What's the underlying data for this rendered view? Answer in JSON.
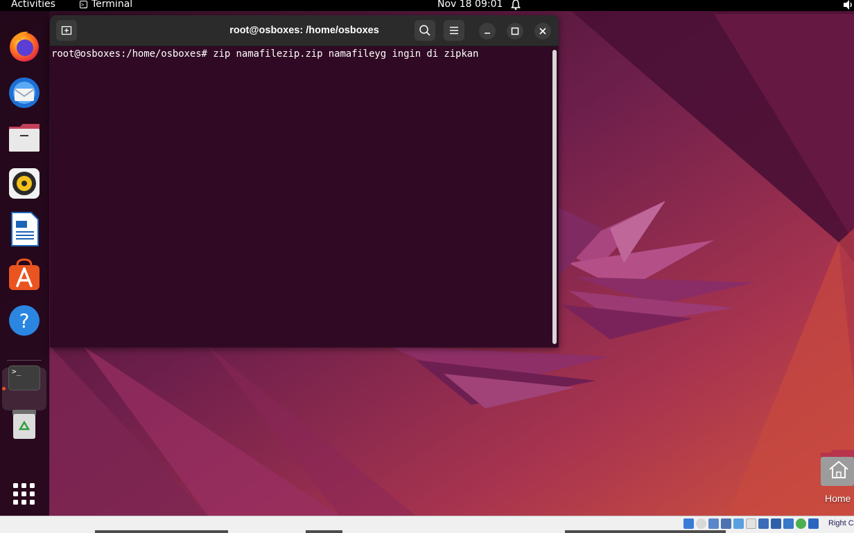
{
  "topbar": {
    "activities": "Activities",
    "app_name": "Terminal",
    "clock": "Nov 18  09:01",
    "terminal_glyph": ">_"
  },
  "dock": {
    "items": [
      {
        "name": "firefox-icon"
      },
      {
        "name": "thunderbird-icon"
      },
      {
        "name": "files-icon"
      },
      {
        "name": "rhythmbox-icon"
      },
      {
        "name": "libreoffice-writer-icon"
      },
      {
        "name": "software-center-icon"
      },
      {
        "name": "help-icon"
      },
      {
        "name": "terminal-icon",
        "glyph": ">_"
      },
      {
        "name": "trash-icon"
      },
      {
        "name": "show-apps-icon"
      }
    ]
  },
  "terminal": {
    "title": "root@osboxes: /home/osboxes",
    "prompt": "root@osboxes:/home/osboxes# ",
    "command": "zip namafilezip.zip namafileyg ingin di zipkan"
  },
  "desktop": {
    "home_label": "Home"
  },
  "statusbar": {
    "host_key": "Right C"
  },
  "colors": {
    "terminal_bg": "#300a24",
    "titlebar_bg": "#2b2b2b",
    "accent": "#e95420"
  }
}
